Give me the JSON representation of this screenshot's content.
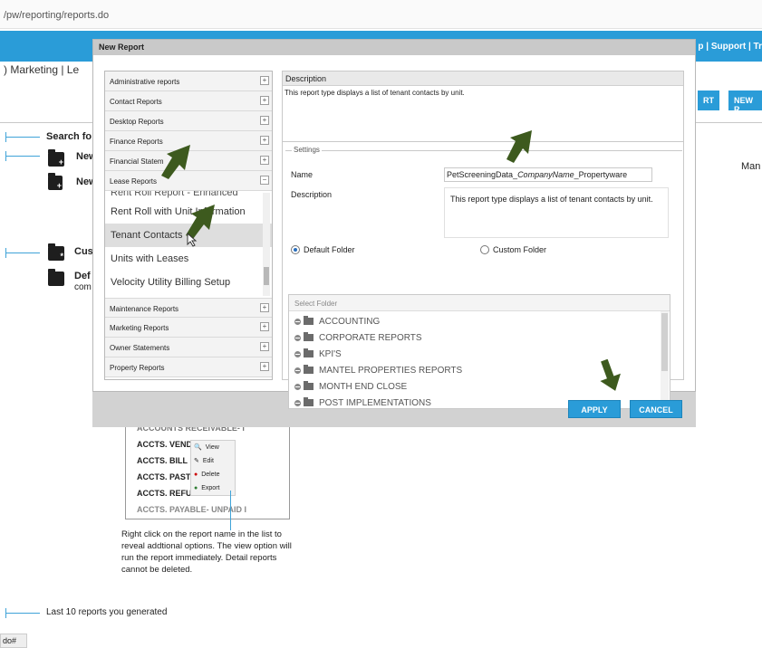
{
  "page": {
    "url": "/pw/reporting/reports.do",
    "top_links": "p | Support | Tr",
    "nav_text": ") Marketing  |  Le",
    "toolbar_btn1": "RT",
    "toolbar_btn2": "NEW R",
    "right_edge_text": "Man",
    "search_label": "Search fo",
    "new1": "New",
    "new2": "New",
    "cust": "Cus",
    "def": "Def",
    "def2": "com",
    "snippet_rows": [
      "ACCOUNTS RECEIVABLE- I",
      "ACCTS.  VENDOR",
      "ACCTS.  BILL PAY",
      "ACCTS.  PAST DU",
      "ACCTS.  REFUND",
      "ACCTS. PAYABLE- UNPAID I"
    ],
    "context_menu": [
      "View",
      "Edit",
      "Delete",
      "Export"
    ],
    "hint_text": "Right click on the report name in the list to reveal addtional options.  The view option will run the report immediately.  Detail reports cannot be deleted.",
    "last10": "Last 10 reports you generated",
    "status": "do#"
  },
  "modal": {
    "title": "New Report",
    "categories_top": [
      "Administrative reports",
      "Contact Reports",
      "Desktop Reports",
      "Finance Reports",
      "Financial Statem",
      "Lease Reports"
    ],
    "sub_items": [
      "Rent Roll Report - Enhanced",
      "Rent Roll with Unit Information",
      "Tenant Contacts",
      "Units with Leases",
      "Velocity Utility Billing Setup"
    ],
    "selected_sub": "Tenant Contacts",
    "categories_bottom": [
      "Maintenance Reports",
      "Marketing Reports",
      "Owner Statements",
      "Property Reports"
    ],
    "description_header": "Description",
    "description_text": "This report type displays a list of tenant contacts by unit.",
    "settings_label": "Settings",
    "name_label": "Name",
    "name_value_prefix": "PetScreeningData_",
    "name_value_italic": "CompanyName",
    "name_value_suffix": "_Propertyware",
    "description_label": "Description",
    "description_value": "This report type displays a list of tenant contacts by unit.",
    "default_folder": "Default Folder",
    "custom_folder": "Custom Folder",
    "select_folder": "Select Folder",
    "folders": [
      "ACCOUNTING",
      "CORPORATE REPORTS",
      "KPI'S",
      "MANTEL PROPERTIES REPORTS",
      "MONTH END CLOSE",
      "POST IMPLEMENTATIONS"
    ],
    "apply": "APPLY",
    "cancel": "CANCEL"
  },
  "colors": {
    "accent": "#2a9cd8",
    "arrow": "#3d5a1e"
  }
}
